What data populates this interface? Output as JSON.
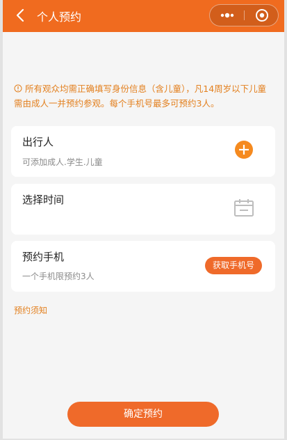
{
  "navbar": {
    "title": "个人预约",
    "back_icon": "chevron-left-icon",
    "more_icon": "more-dots-icon",
    "close_icon": "target-circle-icon",
    "color": "#f06b1f"
  },
  "notice": {
    "icon": "info-circle-icon",
    "text": "所有观众均需正确填写身份信息（含儿童），凡14周岁以下儿童需由成人一并预约参观。每个手机号最多可预约3人。",
    "color": "#e3801f"
  },
  "cards": {
    "traveler": {
      "title": "出行人",
      "subtitle": "可添加成人.学生.儿童",
      "icon": "plus-circle-icon"
    },
    "time": {
      "title": "选择时间",
      "icon": "calendar-icon"
    },
    "phone": {
      "title": "预约手机",
      "subtitle": "一个手机限预约3人",
      "button_label": "获取手机号"
    }
  },
  "notes_link": "预约须知",
  "confirm_button": "确定预约",
  "accent": "#ef6a2a"
}
